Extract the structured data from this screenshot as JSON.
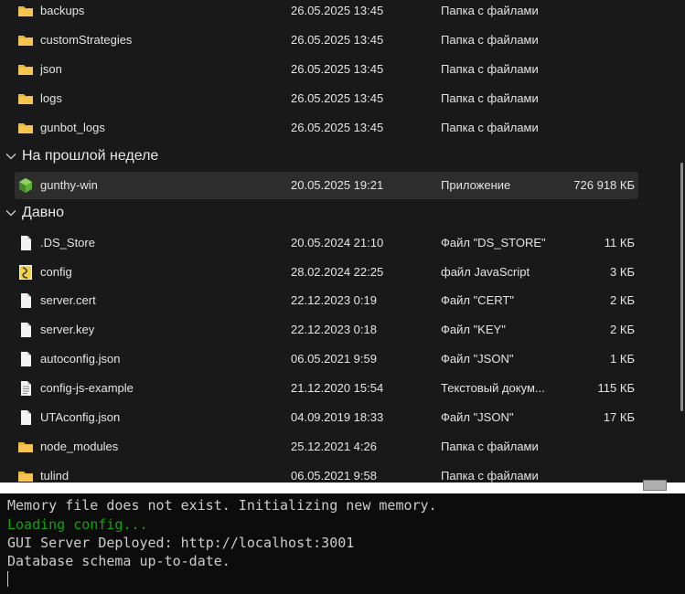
{
  "colors": {
    "folder": "#e8b63f",
    "terminal_green": "#13a10e",
    "terminal_text": "#cccccc",
    "selected_row": "#2d2d2d"
  },
  "groups": {
    "last_week": {
      "label": "На прошлой неделе",
      "icon": "chevron-down-icon"
    },
    "long_ago": {
      "label": "Давно",
      "icon": "chevron-down-icon"
    }
  },
  "files": [
    {
      "name": "backups",
      "date": "26.05.2025 13:45",
      "type": "Папка с файлами",
      "size": "",
      "icon": "folder-icon"
    },
    {
      "name": "customStrategies",
      "date": "26.05.2025 13:45",
      "type": "Папка с файлами",
      "size": "",
      "icon": "folder-icon"
    },
    {
      "name": "json",
      "date": "26.05.2025 13:45",
      "type": "Папка с файлами",
      "size": "",
      "icon": "folder-icon"
    },
    {
      "name": "logs",
      "date": "26.05.2025 13:45",
      "type": "Папка с файлами",
      "size": "",
      "icon": "folder-icon"
    },
    {
      "name": "gunbot_logs",
      "date": "26.05.2025 13:45",
      "type": "Папка с файлами",
      "size": "",
      "icon": "folder-icon"
    },
    {
      "name": "gunthy-win",
      "date": "20.05.2025 19:21",
      "type": "Приложение",
      "size": "726 918 КБ",
      "icon": "app-cube-icon"
    },
    {
      "name": ".DS_Store",
      "date": "20.05.2024 21:10",
      "type": "Файл \"DS_STORE\"",
      "size": "11 КБ",
      "icon": "file-icon"
    },
    {
      "name": "config",
      "date": "28.02.2024 22:25",
      "type": "файл JavaScript",
      "size": "3 КБ",
      "icon": "js-file-icon"
    },
    {
      "name": "server.cert",
      "date": "22.12.2023 0:19",
      "type": "Файл \"CERT\"",
      "size": "2 КБ",
      "icon": "file-icon"
    },
    {
      "name": "server.key",
      "date": "22.12.2023 0:18",
      "type": "Файл \"KEY\"",
      "size": "2 КБ",
      "icon": "file-icon"
    },
    {
      "name": "autoconfig.json",
      "date": "06.05.2021 9:59",
      "type": "Файл \"JSON\"",
      "size": "1 КБ",
      "icon": "file-icon"
    },
    {
      "name": "config-js-example",
      "date": "21.12.2020 15:54",
      "type": "Текстовый докум...",
      "size": "115 КБ",
      "icon": "text-file-icon"
    },
    {
      "name": "UTAconfig.json",
      "date": "04.09.2019 18:33",
      "type": "Файл \"JSON\"",
      "size": "17 КБ",
      "icon": "file-icon"
    },
    {
      "name": "node_modules",
      "date": "25.12.2021 4:26",
      "type": "Папка с файлами",
      "size": "",
      "icon": "folder-icon"
    },
    {
      "name": "tulind",
      "date": "06.05.2021 9:58",
      "type": "Папка с файлами",
      "size": "",
      "icon": "folder-icon"
    }
  ],
  "terminal": {
    "lines": [
      {
        "text": "Memory file does not exist. Initializing new memory.",
        "color": "#cccccc"
      },
      {
        "text": "Loading config...",
        "color": "#13a10e"
      },
      {
        "text": "GUI Server Deployed: http://localhost:3001",
        "color": "#cccccc"
      },
      {
        "text": "Database schema up-to-date.",
        "color": "#cccccc"
      }
    ]
  }
}
